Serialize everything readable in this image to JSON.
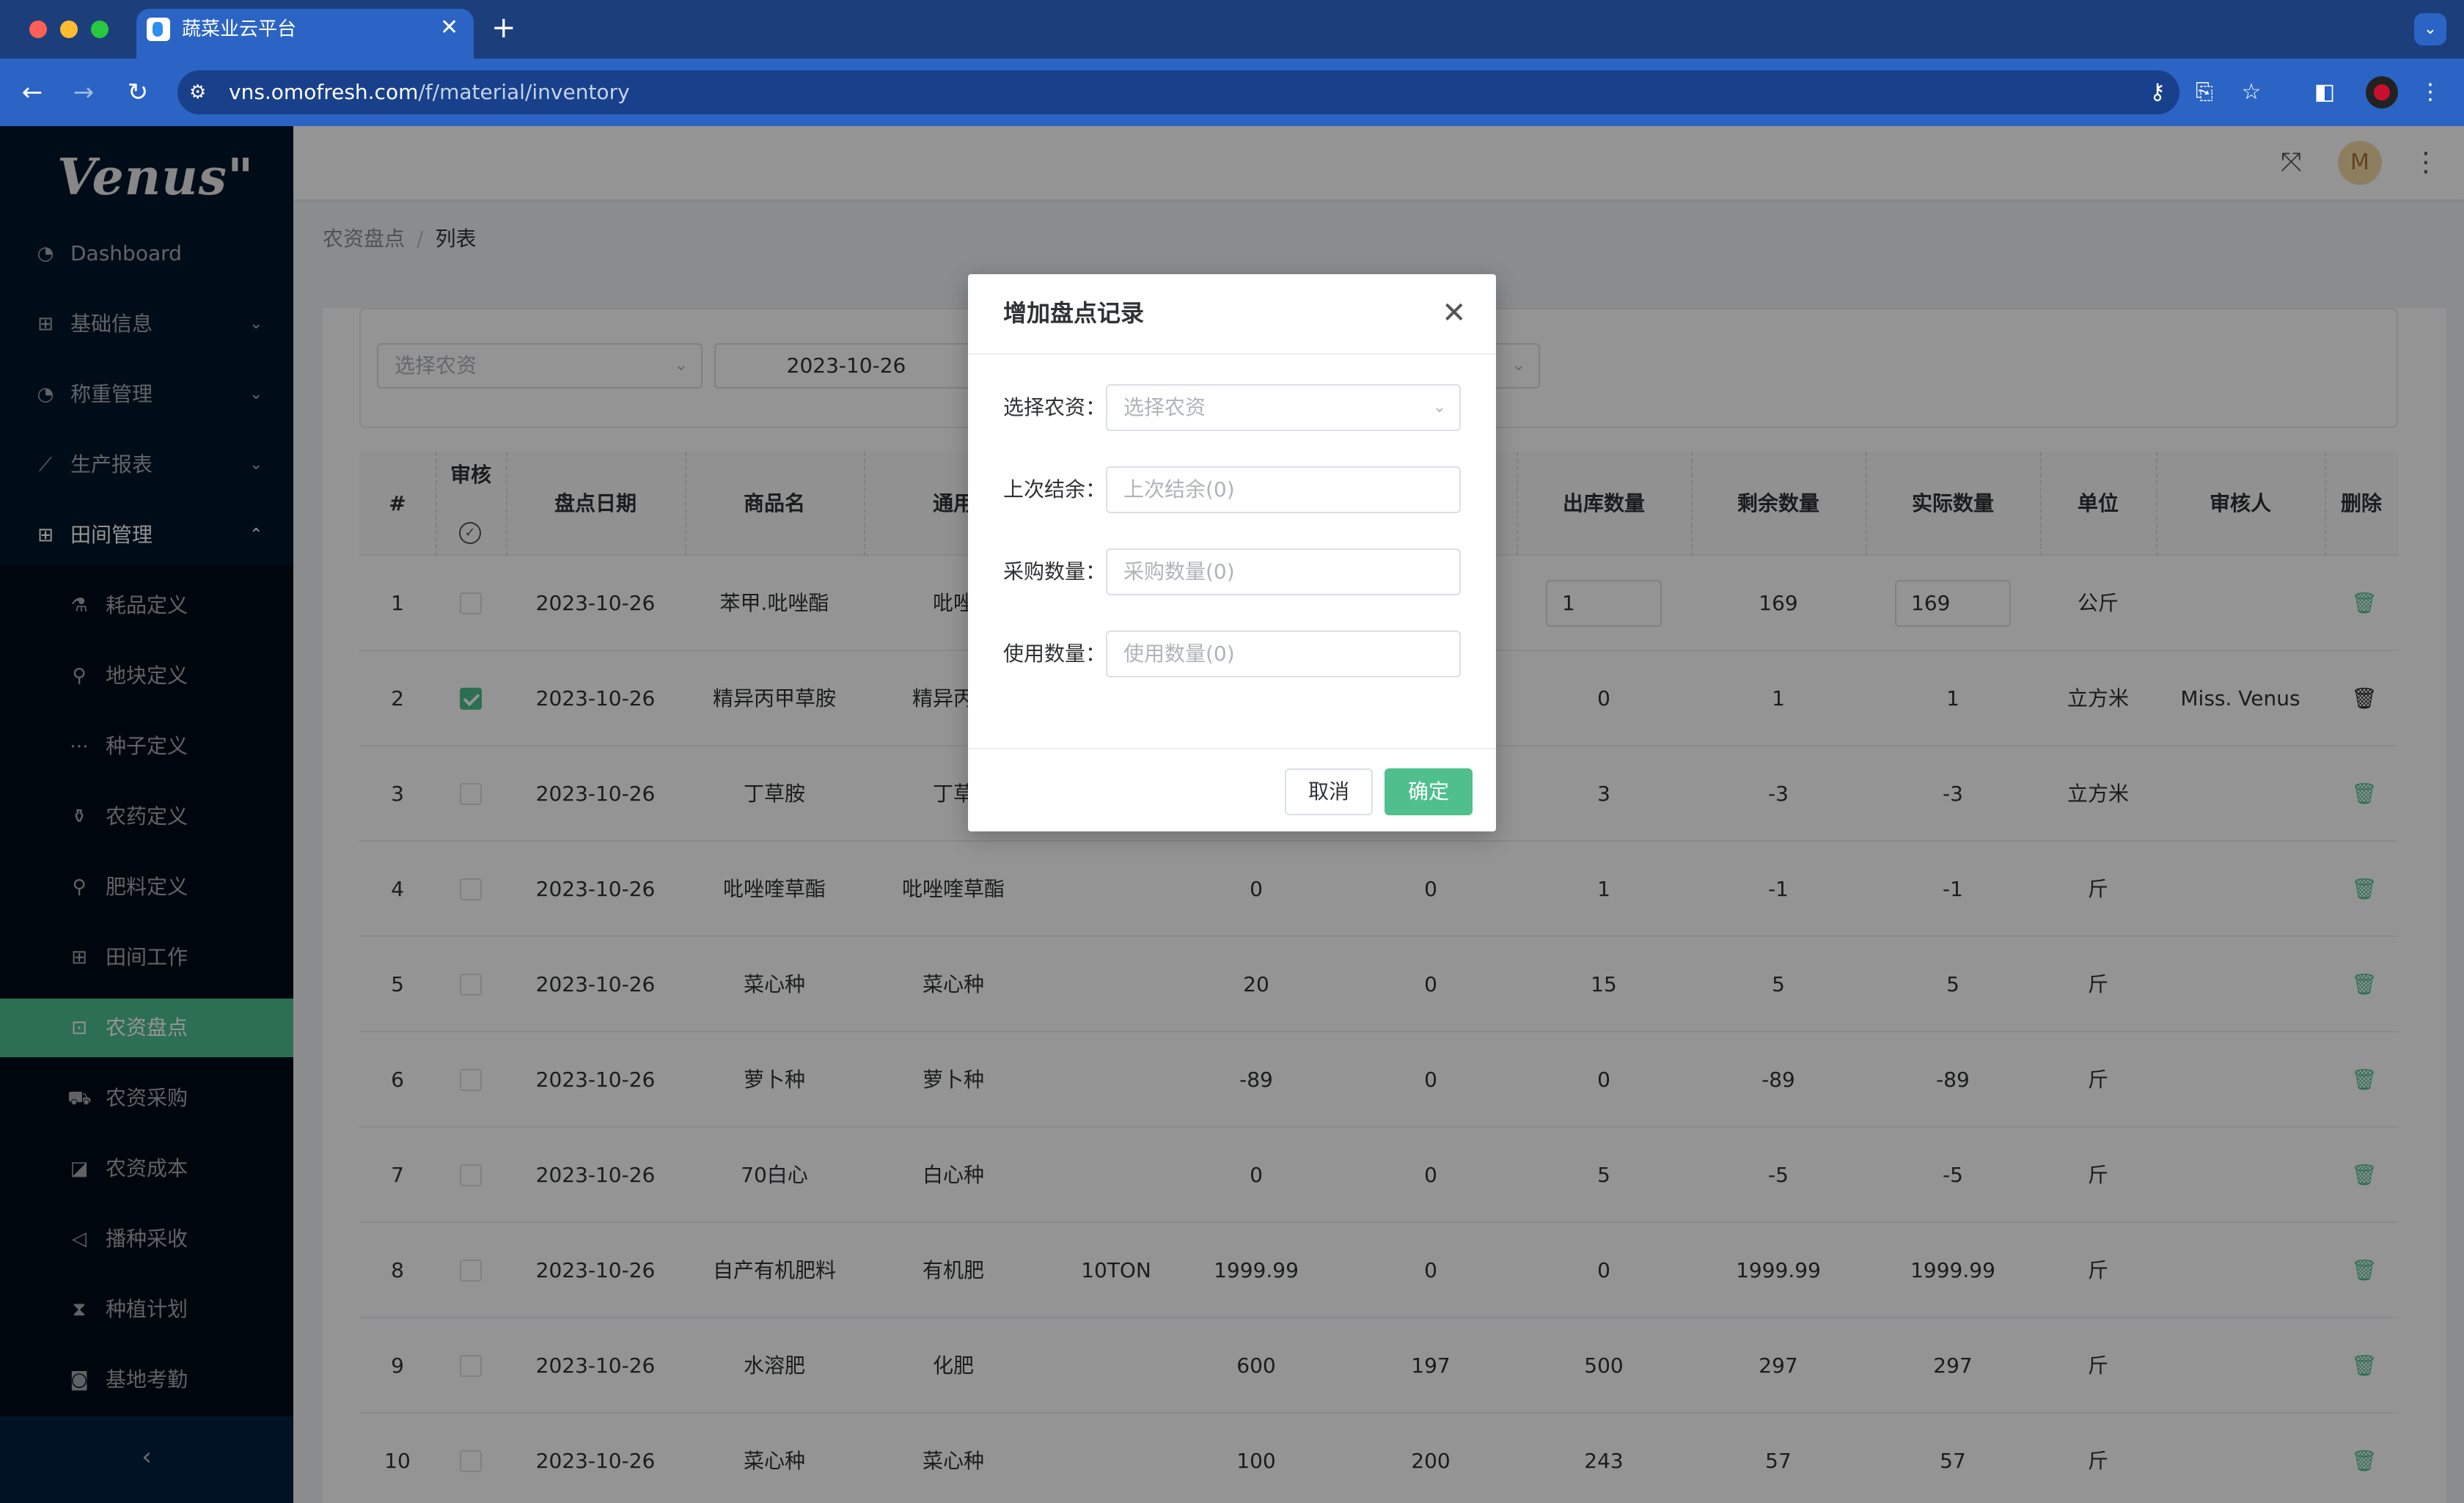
{
  "browser": {
    "tab_title": "蔬菜业云平台",
    "url_host": "vns.omofresh.com",
    "url_path": "/f/material/inventory"
  },
  "sidebar": {
    "logo": "Venus\"",
    "items": [
      {
        "label": "Dashboard",
        "icon": "dashboard-icon"
      },
      {
        "label": "基础信息",
        "icon": "grid-icon"
      },
      {
        "label": "称重管理",
        "icon": "gauge-icon"
      },
      {
        "label": "生产报表",
        "icon": "line-chart-icon"
      },
      {
        "label": "田间管理",
        "icon": "grid-icon"
      }
    ],
    "subitems": [
      {
        "label": "耗品定义",
        "icon": "flask-icon"
      },
      {
        "label": "地块定义",
        "icon": "pin-icon"
      },
      {
        "label": "种子定义",
        "icon": "ellipsis-icon"
      },
      {
        "label": "农药定义",
        "icon": "beaker-icon"
      },
      {
        "label": "肥料定义",
        "icon": "pin-icon"
      },
      {
        "label": "田间工作",
        "icon": "table-icon"
      },
      {
        "label": "农资盘点",
        "icon": "console-icon"
      },
      {
        "label": "农资采购",
        "icon": "cart-icon"
      },
      {
        "label": "农资成本",
        "icon": "area-chart-icon"
      },
      {
        "label": "播种采收",
        "icon": "megaphone-icon"
      },
      {
        "label": "种植计划",
        "icon": "hourglass-icon"
      },
      {
        "label": "基地考勤",
        "icon": "camera-icon"
      }
    ],
    "active": "农资盘点"
  },
  "header": {
    "avatar_letter": "M"
  },
  "breadcrumb": {
    "parent": "农资盘点",
    "separator": "/",
    "current": "列表"
  },
  "filters": {
    "material_placeholder": "选择农资",
    "date_value": "2023-10-26"
  },
  "table": {
    "headers": {
      "index": "#",
      "audit": "审核",
      "date": "盘点日期",
      "product": "商品名",
      "generic": "通用",
      "out_qty": "出库数量",
      "remain_qty": "剩余数量",
      "actual_qty": "实际数量",
      "unit": "单位",
      "auditor": "审核人",
      "delete": "删除"
    },
    "rows": [
      {
        "idx": "1",
        "checked": false,
        "date": "2023-10-26",
        "product": "苯甲.吡唑酯",
        "generic": "吡唑",
        "spec": "",
        "last": "",
        "purchase": "",
        "out": "1",
        "remain": "169",
        "actual": "169",
        "unit": "公斤",
        "auditor": "",
        "editable": true
      },
      {
        "idx": "2",
        "checked": true,
        "date": "2023-10-26",
        "product": "精异丙甲草胺",
        "generic": "精异丙甲",
        "spec": "",
        "last": "",
        "purchase": "",
        "out": "0",
        "remain": "1",
        "actual": "1",
        "unit": "立方米",
        "auditor": "Miss. Venus",
        "editable": false
      },
      {
        "idx": "3",
        "checked": false,
        "date": "2023-10-26",
        "product": "丁草胺",
        "generic": "丁草",
        "spec": "",
        "last": "",
        "purchase": "",
        "out": "3",
        "remain": "-3",
        "actual": "-3",
        "unit": "立方米",
        "auditor": "",
        "editable": false
      },
      {
        "idx": "4",
        "checked": false,
        "date": "2023-10-26",
        "product": "吡唑喹草酯",
        "generic": "吡唑喹草酯",
        "spec": "",
        "last": "0",
        "purchase": "0",
        "out": "1",
        "remain": "-1",
        "actual": "-1",
        "unit": "斤",
        "auditor": "",
        "editable": false
      },
      {
        "idx": "5",
        "checked": false,
        "date": "2023-10-26",
        "product": "菜心种",
        "generic": "菜心种",
        "spec": "",
        "last": "20",
        "purchase": "0",
        "out": "15",
        "remain": "5",
        "actual": "5",
        "unit": "斤",
        "auditor": "",
        "editable": false
      },
      {
        "idx": "6",
        "checked": false,
        "date": "2023-10-26",
        "product": "萝卜种",
        "generic": "萝卜种",
        "spec": "",
        "last": "-89",
        "purchase": "0",
        "out": "0",
        "remain": "-89",
        "actual": "-89",
        "unit": "斤",
        "auditor": "",
        "editable": false
      },
      {
        "idx": "7",
        "checked": false,
        "date": "2023-10-26",
        "product": "70白心",
        "generic": "白心种",
        "spec": "",
        "last": "0",
        "purchase": "0",
        "out": "5",
        "remain": "-5",
        "actual": "-5",
        "unit": "斤",
        "auditor": "",
        "editable": false
      },
      {
        "idx": "8",
        "checked": false,
        "date": "2023-10-26",
        "product": "自产有机肥料",
        "generic": "有机肥",
        "spec": "10TON",
        "last": "1999.99",
        "purchase": "0",
        "out": "0",
        "remain": "1999.99",
        "actual": "1999.99",
        "unit": "斤",
        "auditor": "",
        "editable": false
      },
      {
        "idx": "9",
        "checked": false,
        "date": "2023-10-26",
        "product": "水溶肥",
        "generic": "化肥",
        "spec": "",
        "last": "600",
        "purchase": "197",
        "out": "500",
        "remain": "297",
        "actual": "297",
        "unit": "斤",
        "auditor": "",
        "editable": false
      },
      {
        "idx": "10",
        "checked": false,
        "date": "2023-10-26",
        "product": "菜心种",
        "generic": "菜心种",
        "spec": "",
        "last": "100",
        "purchase": "200",
        "out": "243",
        "remain": "57",
        "actual": "57",
        "unit": "斤",
        "auditor": "",
        "editable": false
      }
    ]
  },
  "modal": {
    "title": "增加盘点记录",
    "fields": [
      {
        "label": "选择农资：",
        "placeholder": "选择农资",
        "type": "select"
      },
      {
        "label": "上次结余：",
        "placeholder": "上次结余(0)",
        "type": "input"
      },
      {
        "label": "采购数量：",
        "placeholder": "采购数量(0)",
        "type": "input"
      },
      {
        "label": "使用数量：",
        "placeholder": "使用数量(0)",
        "type": "input"
      }
    ],
    "cancel_label": "取消",
    "ok_label": "确定"
  },
  "colors": {
    "accent": "#4fc08d",
    "sidebar_bg": "#001529",
    "browser_blue": "#2b64c4"
  }
}
